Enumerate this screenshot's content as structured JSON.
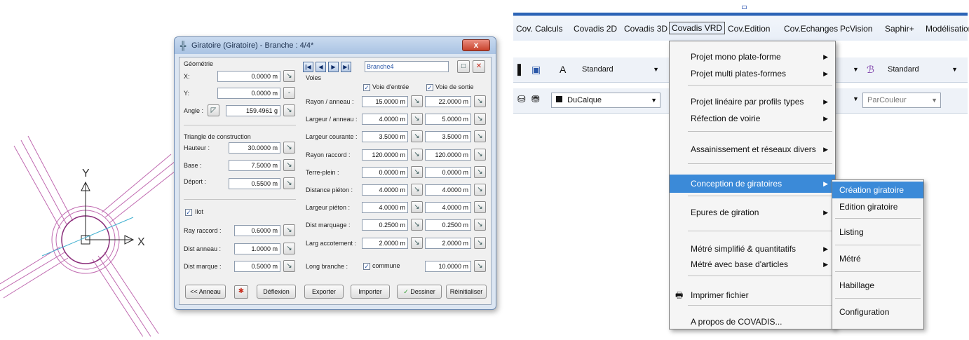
{
  "dialog": {
    "title": "Giratoire (Giratoire) - Branche : 4/4*",
    "close_label": "x",
    "geometry": {
      "group_label": "Géométrie",
      "x_label": "X:",
      "x_value": "0.0000 m",
      "y_label": "Y:",
      "y_value": "0.0000 m",
      "y_button": "-",
      "angle_label": "Angle :",
      "angle_value": "159.4961 g"
    },
    "triangle": {
      "group_label": "Triangle de construction",
      "hauteur_label": "Hauteur :",
      "hauteur_value": "30.0000 m",
      "base_label": "Base :",
      "base_value": "7.5000 m",
      "deport_label": "Déport :",
      "deport_value": "0.5500 m"
    },
    "ilot": {
      "checkbox_label": "Ilot",
      "ray_label": "Ray raccord :",
      "ray_value": "0.6000 m",
      "dist_anneau_label": "Dist anneau :",
      "dist_anneau_value": "1.0000 m",
      "dist_marque_label": "Dist marque :",
      "dist_marque_value": "0.5000 m"
    },
    "branch_name": "Branche4",
    "voies": {
      "group_label": "Voies",
      "entree_label": "Voie d'entrée",
      "sortie_label": "Voie de sortie",
      "rows": [
        {
          "label": "Rayon / anneau :",
          "entree": "15.0000 m",
          "sortie": "22.0000 m"
        },
        {
          "label": "Largeur / anneau :",
          "entree": "4.0000 m",
          "sortie": "5.0000 m"
        },
        {
          "label": "Largeur courante :",
          "entree": "3.5000 m",
          "sortie": "3.5000 m"
        },
        {
          "label": "Rayon raccord :",
          "entree": "120.0000 m",
          "sortie": "120.0000 m"
        },
        {
          "label": "Terre-plein :",
          "entree": "0.0000 m",
          "sortie": "0.0000 m"
        },
        {
          "label": "Distance piéton :",
          "entree": "4.0000 m",
          "sortie": "4.0000 m"
        },
        {
          "label": "Largeur piéton :",
          "entree": "4.0000 m",
          "sortie": "4.0000 m"
        },
        {
          "label": "Dist marquage :",
          "entree": "0.2500 m",
          "sortie": "0.2500 m"
        },
        {
          "label": "Larg accotement :",
          "entree": "2.0000 m",
          "sortie": "2.0000 m"
        }
      ],
      "long_branche_label": "Long branche :",
      "commune_label": "commune",
      "long_branche_value": "10.0000 m"
    },
    "buttons": {
      "anneau": "<< Anneau",
      "deflexion": "Déflexion",
      "exporter": "Exporter",
      "importer": "Importer",
      "dessiner": "Dessiner",
      "reinitialiser": "Réinitialiser"
    }
  },
  "drawing": {
    "y_axis_label": "Y",
    "x_axis_label": "X"
  },
  "menubar": {
    "items": [
      "Cov. Calculs",
      "Covadis 2D",
      "Covadis 3D",
      "Covadis VRD",
      "Cov.Edition",
      "Cov.Echanges",
      "PcVision",
      "Saphir+",
      "Modélisation"
    ],
    "active_index": 3
  },
  "toolbar": {
    "style1": "Standard",
    "style2": "Standard",
    "layer": "DuCalque",
    "color": "ParCouleur"
  },
  "dropdown": {
    "items": [
      {
        "label": "Projet mono plate-forme",
        "submenu": true
      },
      {
        "label": "Projet multi plates-formes",
        "submenu": true
      },
      {
        "label": "Projet linéaire par profils types",
        "submenu": true
      },
      {
        "label": "Réfection de voirie",
        "submenu": true
      },
      {
        "label": "Assainissement et réseaux divers",
        "submenu": true
      },
      {
        "label": "Conception de giratoires",
        "submenu": true
      },
      {
        "label": "Epures de giration",
        "submenu": true
      },
      {
        "label": "Métré simplifié & quantitatifs",
        "submenu": true
      },
      {
        "label": "Métré avec base d'articles",
        "submenu": true
      },
      {
        "label": "Imprimer fichier",
        "submenu": false
      },
      {
        "label": "A propos de COVADIS...",
        "submenu": false
      }
    ],
    "submenu_arrow": "▶"
  },
  "submenu": {
    "items": [
      "Création giratoire",
      "Edition giratoire",
      "Listing",
      "Métré",
      "Habillage",
      "Configuration"
    ]
  },
  "colors": {
    "highlight": "#3b8ad8",
    "road_lines": "#c06ab0",
    "axis": "#222222"
  }
}
